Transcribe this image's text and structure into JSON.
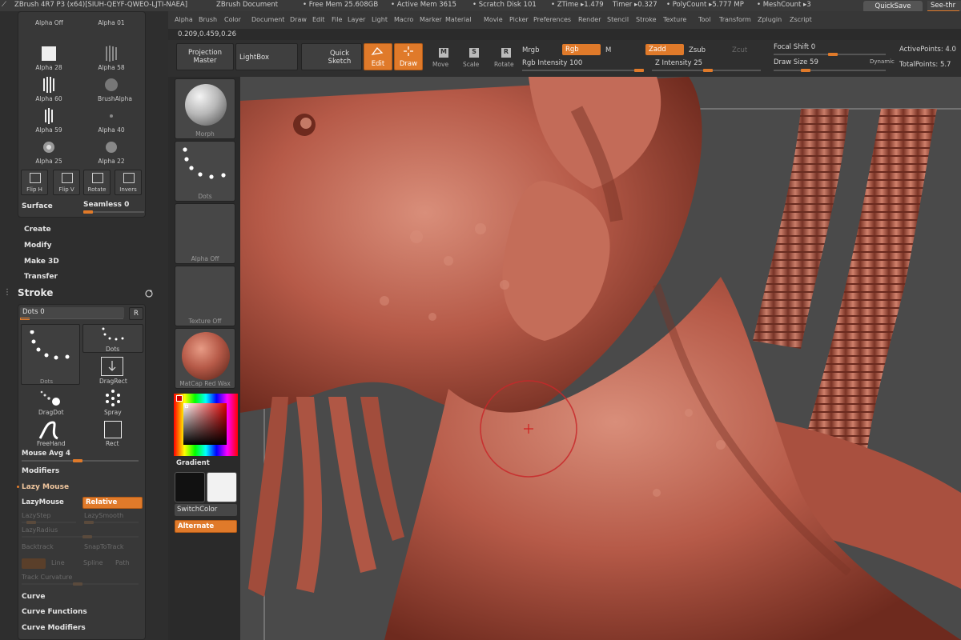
{
  "titlebar": {
    "app": "ZBrush 4R7 P3 (x64)[SIUH-QEYF-QWEO-LJTI-NAEA]",
    "document": "ZBrush Document",
    "free_mem": "• Free Mem 25.608GB",
    "active_mem": "• Active Mem 3615",
    "scratch_disk": "• Scratch Disk 101",
    "ztime": "• ZTime ▸1.479",
    "timer": "Timer ▸0.327",
    "polycount": "• PolyCount ▸5.777 MP",
    "meshcount": "• MeshCount ▸3",
    "quicksave": "QuickSave",
    "seethrough": "See-thr"
  },
  "menu": [
    "Alpha",
    "Brush",
    "Color",
    "Document",
    "Draw",
    "Edit",
    "File",
    "Layer",
    "Light",
    "Macro",
    "Marker",
    "Material",
    "Movie",
    "Picker",
    "Preferences",
    "Render",
    "Stencil",
    "Stroke",
    "Texture",
    "Tool",
    "Transform",
    "Zplugin",
    "Zscript"
  ],
  "coords": "0.209,0.459,0.26",
  "toolbar": {
    "projection_master": "Projection Master",
    "lightbox": "LightBox",
    "quick_sketch": "Quick Sketch",
    "edit": "Edit",
    "draw": "Draw",
    "move": "Move",
    "scale": "Scale",
    "rotate": "Rotate",
    "mrgb": "Mrgb",
    "rgb": "Rgb",
    "m": "M",
    "zadd": "Zadd",
    "zsub": "Zsub",
    "zcut": "Zcut",
    "rgb_intensity": "Rgb Intensity 100",
    "z_intensity": "Z Intensity 25",
    "focal_shift": "Focal Shift 0",
    "draw_size": "Draw Size 59",
    "dynamic": "Dynamic",
    "active_points": "ActivePoints: 4.0",
    "total_points": "TotalPoints: 5.7"
  },
  "alpha_palette": {
    "items": [
      {
        "label": "Alpha Off"
      },
      {
        "label": "Alpha 01"
      },
      {
        "label": "Alpha 28"
      },
      {
        "label": "Alpha 58"
      },
      {
        "label": "Alpha 60"
      },
      {
        "label": "BrushAlpha"
      },
      {
        "label": "Alpha 59"
      },
      {
        "label": "Alpha 40"
      },
      {
        "label": "Alpha 25"
      },
      {
        "label": "Alpha 22"
      }
    ],
    "buttons": [
      "Flip H",
      "Flip V",
      "Rotate",
      "Invers"
    ],
    "surface": "Surface",
    "seamless": "Seamless 0"
  },
  "sections": [
    "Create",
    "Modify",
    "Make 3D",
    "Transfer"
  ],
  "stroke": {
    "title": "Stroke",
    "dots": "Dots 0",
    "r": "R",
    "types": [
      "Dots",
      "Dots",
      "DragRect",
      "DragDot",
      "Spray",
      "FreeHand",
      "Rect"
    ],
    "mouse_avg": "Mouse Avg 4",
    "modifiers": "Modifiers",
    "lazy_mouse": "Lazy Mouse",
    "lazymouse_btn": "LazyMouse",
    "relative": "Relative",
    "lazystep": "LazyStep",
    "lazysmooth": "LazySmooth",
    "lazyradius": "LazyRadius",
    "backtrack": "Backtrack",
    "snaptotrack": "SnapToTrack",
    "line": "Line",
    "spline": "Spline",
    "path": "Path",
    "track_curvature": "Track Curvature",
    "curve": "Curve",
    "curve_functions": "Curve Functions",
    "curve_modifiers": "Curve Modifiers"
  },
  "shelf": {
    "material": "Morph",
    "stroke": "Dots",
    "alpha": "Alpha Off",
    "texture": "Texture Off",
    "matcap": "MatCap Red Wax",
    "gradient": "Gradient",
    "switchcolor": "SwitchColor",
    "alternate": "Alternate"
  },
  "colors": {
    "accent": "#e07a2a",
    "skin": "#b65a48",
    "background": "#484848"
  }
}
